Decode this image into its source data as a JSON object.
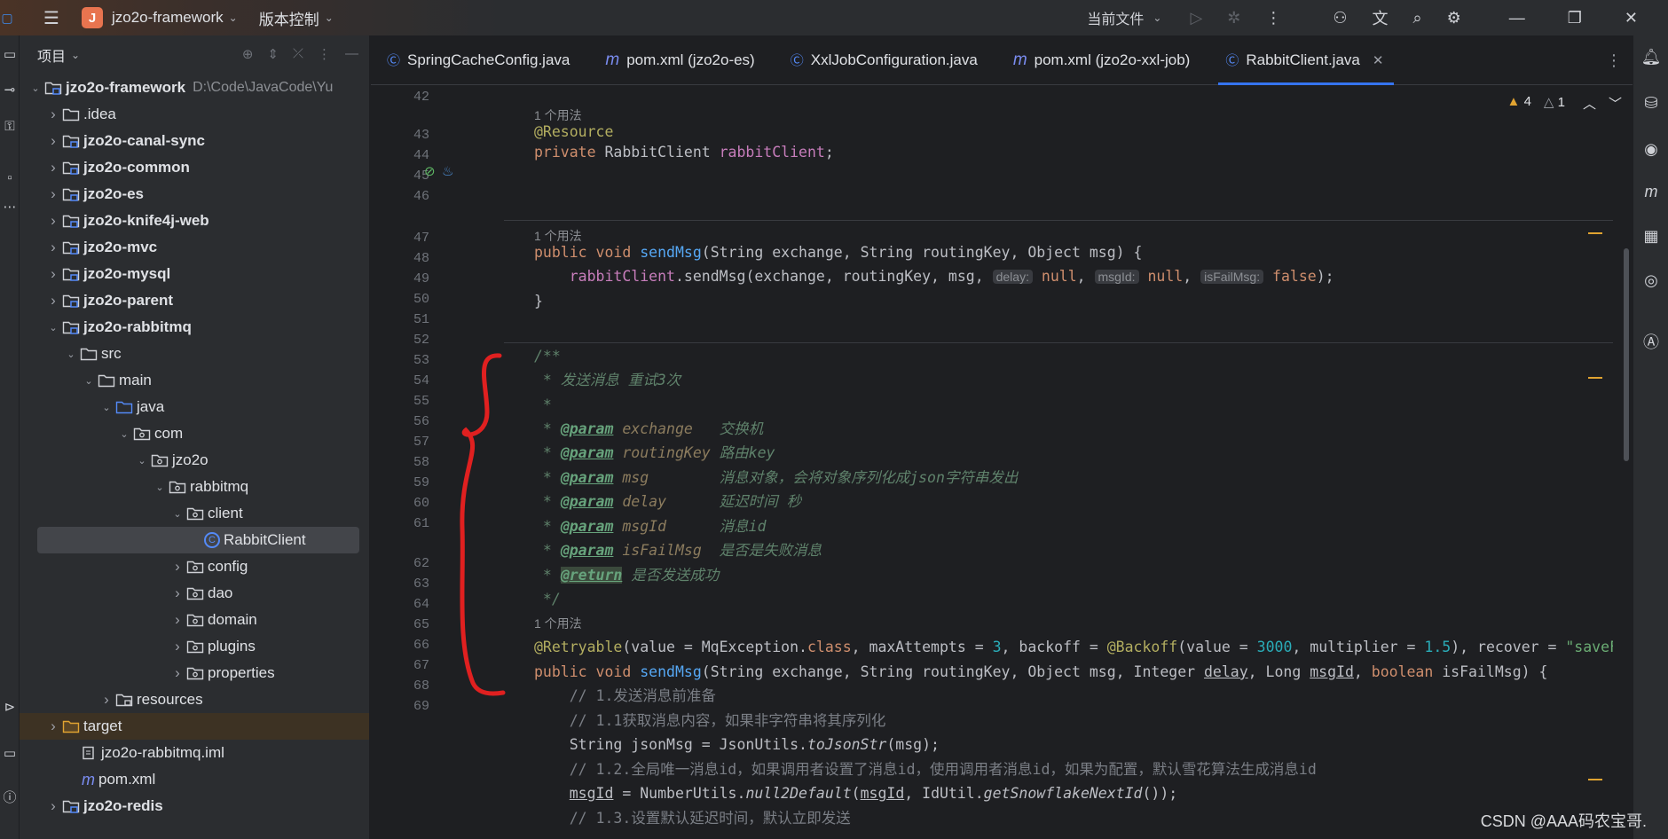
{
  "titlebar": {
    "project_initial": "J",
    "project_name": "jzo2o-framework",
    "vcs_label": "版本控制",
    "run_config": "当前文件"
  },
  "project_panel": {
    "title": "项目",
    "rows": [
      {
        "label": "jzo2o-framework",
        "path": "D:\\Code\\JavaCode\\Yu",
        "kind": "module",
        "expanded": true
      },
      {
        "label": ".idea",
        "kind": "folder",
        "expanded": false
      },
      {
        "label": "jzo2o-canal-sync",
        "kind": "module",
        "expanded": false
      },
      {
        "label": "jzo2o-common",
        "kind": "module",
        "expanded": false
      },
      {
        "label": "jzo2o-es",
        "kind": "module",
        "expanded": false
      },
      {
        "label": "jzo2o-knife4j-web",
        "kind": "module",
        "expanded": false
      },
      {
        "label": "jzo2o-mvc",
        "kind": "module",
        "expanded": false
      },
      {
        "label": "jzo2o-mysql",
        "kind": "module",
        "expanded": false
      },
      {
        "label": "jzo2o-parent",
        "kind": "module",
        "expanded": false
      },
      {
        "label": "jzo2o-rabbitmq",
        "kind": "module",
        "expanded": true
      },
      {
        "label": "src",
        "kind": "folder",
        "expanded": true
      },
      {
        "label": "main",
        "kind": "folder",
        "expanded": true
      },
      {
        "label": "java",
        "kind": "source",
        "expanded": true
      },
      {
        "label": "com",
        "kind": "package",
        "expanded": true
      },
      {
        "label": "jzo2o",
        "kind": "package",
        "expanded": true
      },
      {
        "label": "rabbitmq",
        "kind": "package",
        "expanded": true
      },
      {
        "label": "client",
        "kind": "package",
        "expanded": true
      },
      {
        "label": "RabbitClient",
        "kind": "class"
      },
      {
        "label": "config",
        "kind": "package",
        "expanded": false
      },
      {
        "label": "dao",
        "kind": "package",
        "expanded": false
      },
      {
        "label": "domain",
        "kind": "package",
        "expanded": false
      },
      {
        "label": "plugins",
        "kind": "package",
        "expanded": false
      },
      {
        "label": "properties",
        "kind": "package",
        "expanded": false
      },
      {
        "label": "resources",
        "kind": "resources",
        "expanded": false
      },
      {
        "label": "target",
        "kind": "excluded",
        "expanded": false
      },
      {
        "label": "jzo2o-rabbitmq.iml",
        "kind": "file"
      },
      {
        "label": "pom.xml",
        "kind": "maven"
      },
      {
        "label": "jzo2o-redis",
        "kind": "module",
        "expanded": false
      }
    ]
  },
  "tabs": [
    {
      "label": "SpringCacheConfig.java",
      "icon": "class-icon"
    },
    {
      "label": "pom.xml (jzo2o-es)",
      "icon": "maven-icon"
    },
    {
      "label": "XxlJobConfiguration.java",
      "icon": "class-icon"
    },
    {
      "label": "pom.xml (jzo2o-xxl-job)",
      "icon": "maven-icon"
    },
    {
      "label": "RabbitClient.java",
      "icon": "class-icon",
      "active": true
    }
  ],
  "inspections": {
    "warnings": "4",
    "weak_warnings": "1"
  },
  "editor": {
    "usage_hint": "1 个用法",
    "line_numbers": [
      "42",
      "43",
      "44",
      "45",
      "46",
      "47",
      "48",
      "49",
      "50",
      "51",
      "52",
      "53",
      "54",
      "55",
      "56",
      "57",
      "58",
      "59",
      "60",
      "61",
      "62",
      "63",
      "64",
      "65",
      "66",
      "67",
      "68",
      "69"
    ],
    "hint_delay": "delay:",
    "hint_msgId": "msgId:",
    "hint_isFailMsg": "isFailMsg:",
    "doc_title": " * 发送消息 重试3次",
    "doc_exchange": "交换机",
    "doc_routingKey": "路由key",
    "doc_msg": "消息对象，会将对象序列化成json字符串发出",
    "doc_delay": "延迟时间 秒",
    "doc_msgId": "消息id",
    "doc_isFailMsg": "是否是失败消息",
    "doc_return": "是否发送成功",
    "c64": "// 1.发送消息前准备",
    "c65": "// 1.1获取消息内容，如果非字符串将其序列化",
    "c67": "// 1.2.全局唯一消息id，如果调用者设置了消息id，使用调用者消息id，如果为配置，默认雪花算法生成消息id",
    "c69": "// 1.3.设置默认延迟时间，默认立即发送"
  },
  "colors": {
    "accent": "#3574f0",
    "annotation_pen": "#e02020"
  },
  "watermark": "CSDN @AAA码农宝哥."
}
